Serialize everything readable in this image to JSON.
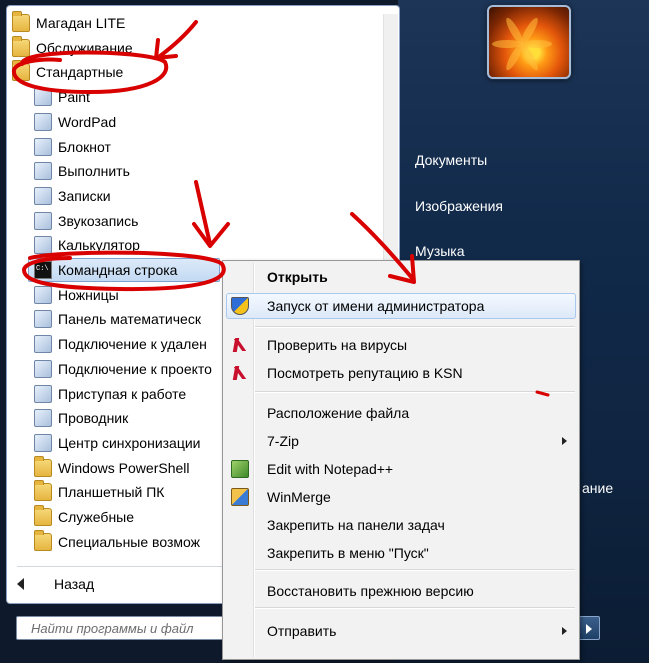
{
  "colors": {
    "annotation": "#d90000",
    "taskbar": "#112a4a",
    "menu_highlight": "#dde9f8"
  },
  "user": {
    "picture": "flower-avatar"
  },
  "right_links": [
    "Документы",
    "Изображения",
    "Музыка",
    "ание"
  ],
  "programs": {
    "items": [
      {
        "label": "Магадан LITE",
        "icon": "folder-icon"
      },
      {
        "label": "Обслуживание",
        "icon": "folder-icon"
      },
      {
        "label": "Стандартные",
        "icon": "folder-icon"
      },
      {
        "label": "Paint",
        "icon": "paint-icon"
      },
      {
        "label": "WordPad",
        "icon": "wordpad-icon"
      },
      {
        "label": "Блокнот",
        "icon": "notepad-icon"
      },
      {
        "label": "Выполнить",
        "icon": "run-icon"
      },
      {
        "label": "Записки",
        "icon": "sticky-notes-icon"
      },
      {
        "label": "Звукозапись",
        "icon": "microphone-icon"
      },
      {
        "label": "Калькулятор",
        "icon": "calculator-icon"
      },
      {
        "label": "Командная строка",
        "icon": "cmd-icon"
      },
      {
        "label": "Ножницы",
        "icon": "scissors-icon"
      },
      {
        "label": "Панель математическ",
        "icon": "math-panel-icon"
      },
      {
        "label": "Подключение к удален",
        "icon": "remote-desktop-icon"
      },
      {
        "label": "Подключение к проекто",
        "icon": "projector-icon"
      },
      {
        "label": "Приступая к работе",
        "icon": "getting-started-icon"
      },
      {
        "label": "Проводник",
        "icon": "explorer-icon"
      },
      {
        "label": "Центр синхронизации",
        "icon": "sync-center-icon"
      },
      {
        "label": "Windows PowerShell",
        "icon": "folder-icon"
      },
      {
        "label": "Планшетный ПК",
        "icon": "folder-icon"
      },
      {
        "label": "Служебные",
        "icon": "folder-icon"
      },
      {
        "label": "Специальные возмож",
        "icon": "folder-icon"
      }
    ],
    "back_label": "Назад",
    "selected": "Командная строка"
  },
  "search": {
    "placeholder": "Найти программы и файл"
  },
  "context_menu": {
    "items": [
      {
        "label": "Открыть",
        "bold": true,
        "icon": ""
      },
      {
        "label": "Запуск от имени администратора",
        "icon": "uac-shield-icon"
      },
      {
        "label": "Проверить на вирусы",
        "icon": "kaspersky-icon"
      },
      {
        "label": "Посмотреть репутацию в KSN",
        "icon": "kaspersky-icon"
      },
      {
        "label": "Расположение файла",
        "icon": ""
      },
      {
        "label": "7-Zip",
        "icon": "",
        "submenu": true
      },
      {
        "label": "Edit with Notepad++",
        "icon": "notepadpp-icon"
      },
      {
        "label": "WinMerge",
        "icon": "winmerge-icon"
      },
      {
        "label": "Закрепить на панели задач",
        "icon": ""
      },
      {
        "label": "Закрепить в меню \"Пуск\"",
        "icon": ""
      },
      {
        "label": "Восстановить прежнюю версию",
        "icon": ""
      },
      {
        "label": "Отправить",
        "icon": "",
        "submenu": true
      }
    ],
    "highlighted": "Запуск от имени администратора"
  }
}
